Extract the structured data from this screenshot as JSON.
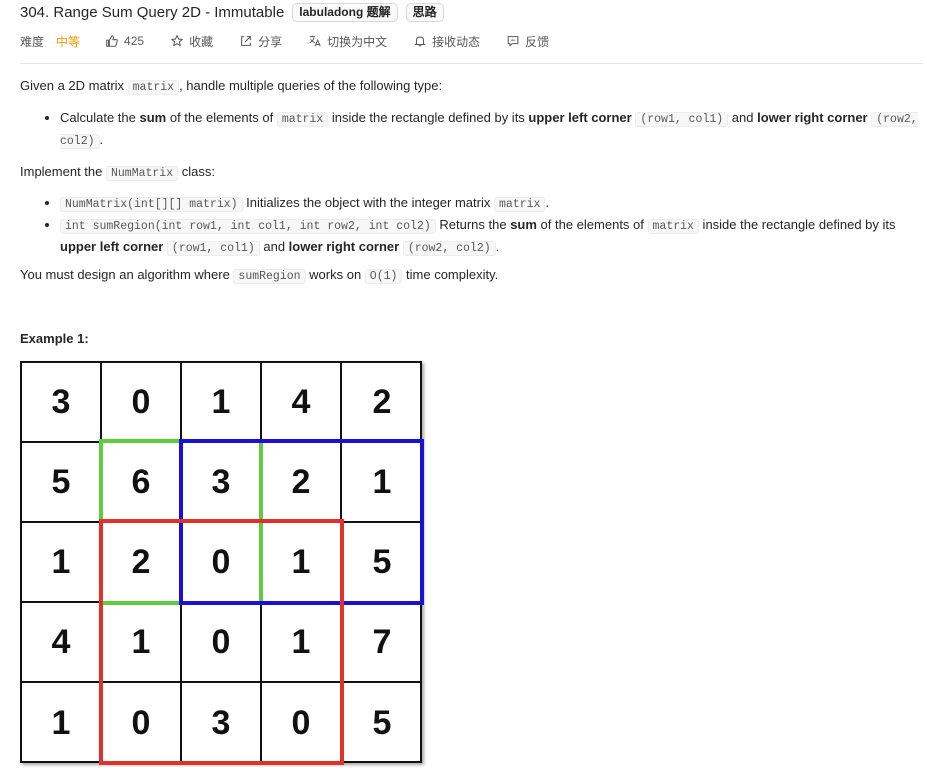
{
  "problem": {
    "title": "304. Range Sum Query 2D - Immutable",
    "tags": [
      "labuladong 题解",
      "思路"
    ]
  },
  "meta": {
    "difficulty_label": "难度",
    "difficulty_value": "中等",
    "likes": "425",
    "favorite": "收藏",
    "share": "分享",
    "translate": "切换为中文",
    "notify": "接收动态",
    "feedback": "反馈",
    "difficulty_color": "#ff9800"
  },
  "description": {
    "p1_a": "Given a 2D matrix ",
    "p1_code": "matrix",
    "p1_b": ", handle multiple queries of the following type:",
    "li1_a": "Calculate the ",
    "li1_b1": "sum",
    "li1_c": " of the elements of ",
    "li1_code1": "matrix",
    "li1_d": " inside the rectangle defined by its ",
    "li1_b2": "upper left corner",
    "li1_code2": "(row1, col1)",
    "li1_e": " and ",
    "li1_b3": "lower right corner",
    "li1_code3": "(row2, col2)",
    "li1_f": ".",
    "p2_a": "Implement the ",
    "p2_code": "NumMatrix",
    "p2_b": " class:",
    "li2_code1": "NumMatrix(int[][] matrix)",
    "li2_a": " Initializes the object with the integer matrix ",
    "li2_code2": "matrix",
    "li2_b": ".",
    "li3_code1": "int sumRegion(int row1, int col1, int row2, int col2)",
    "li3_a": " Returns the ",
    "li3_b1": "sum",
    "li3_c": " of the elements of ",
    "li3_code2": "matrix",
    "li3_d": " inside the rectangle defined by its ",
    "li3_b2": "upper left corner",
    "li3_code3": "(row1, col1)",
    "li3_e": " and ",
    "li3_b3": "lower right corner",
    "li3_code4": "(row2, col2)",
    "li3_f": ".",
    "p3_a": "You must design an algorithm where ",
    "p3_code1": "sumRegion",
    "p3_b": " works on ",
    "p3_code2": "O(1)",
    "p3_c": " time complexity.",
    "example_title": "Example 1:"
  },
  "example_matrix": [
    [
      "3",
      "0",
      "1",
      "4",
      "2"
    ],
    [
      "5",
      "6",
      "3",
      "2",
      "1"
    ],
    [
      "1",
      "2",
      "0",
      "1",
      "5"
    ],
    [
      "4",
      "1",
      "0",
      "1",
      "7"
    ],
    [
      "1",
      "0",
      "3",
      "0",
      "5"
    ]
  ],
  "highlight_colors": {
    "green": "#5fcc3e",
    "blue": "#1a10d6",
    "red": "#e0312a"
  }
}
